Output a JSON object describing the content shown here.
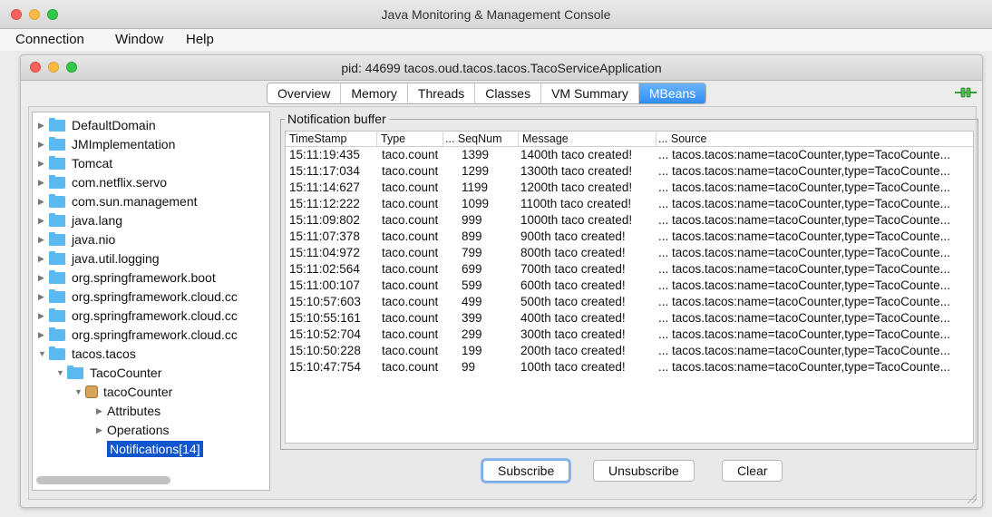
{
  "app": {
    "title": "Java Monitoring & Management Console",
    "menu": [
      "Connection",
      "Window",
      "Help"
    ]
  },
  "window": {
    "title": "pid: 44699 tacos.oud.tacos.tacos.TacoServiceApplication"
  },
  "tabs": [
    {
      "label": "Overview",
      "active": false
    },
    {
      "label": "Memory",
      "active": false
    },
    {
      "label": "Threads",
      "active": false
    },
    {
      "label": "Classes",
      "active": false
    },
    {
      "label": "VM Summary",
      "active": false
    },
    {
      "label": "MBeans",
      "active": true
    }
  ],
  "colors": {
    "accent": "#2f8ef4",
    "selection": "#1155cc",
    "folder": "#5bb8f0"
  },
  "tree": [
    {
      "label": "DefaultDomain",
      "expanded": false,
      "level": 0,
      "icon": "folder-icon"
    },
    {
      "label": "JMImplementation",
      "expanded": false,
      "level": 0,
      "icon": "folder-icon"
    },
    {
      "label": "Tomcat",
      "expanded": false,
      "level": 0,
      "icon": "folder-icon"
    },
    {
      "label": "com.netflix.servo",
      "expanded": false,
      "level": 0,
      "icon": "folder-icon"
    },
    {
      "label": "com.sun.management",
      "expanded": false,
      "level": 0,
      "icon": "folder-icon"
    },
    {
      "label": "java.lang",
      "expanded": false,
      "level": 0,
      "icon": "folder-icon"
    },
    {
      "label": "java.nio",
      "expanded": false,
      "level": 0,
      "icon": "folder-icon"
    },
    {
      "label": "java.util.logging",
      "expanded": false,
      "level": 0,
      "icon": "folder-icon"
    },
    {
      "label": "org.springframework.boot",
      "expanded": false,
      "level": 0,
      "icon": "folder-icon"
    },
    {
      "label": "org.springframework.cloud.cc",
      "expanded": false,
      "level": 0,
      "icon": "folder-icon"
    },
    {
      "label": "org.springframework.cloud.cc",
      "expanded": false,
      "level": 0,
      "icon": "folder-icon"
    },
    {
      "label": "org.springframework.cloud.cc",
      "expanded": false,
      "level": 0,
      "icon": "folder-icon"
    },
    {
      "label": "tacos.tacos",
      "expanded": true,
      "level": 0,
      "icon": "folder-icon"
    },
    {
      "label": "TacoCounter",
      "expanded": true,
      "level": 1,
      "icon": "folder-icon"
    },
    {
      "label": "tacoCounter",
      "expanded": true,
      "level": 2,
      "icon": "bean-icon"
    },
    {
      "label": "Attributes",
      "expanded": false,
      "level": 3,
      "icon": ""
    },
    {
      "label": "Operations",
      "expanded": false,
      "level": 3,
      "icon": ""
    },
    {
      "label": "Notifications[14]",
      "expanded": null,
      "level": 3,
      "icon": "",
      "selected": true
    }
  ],
  "notifications": {
    "title": "Notification buffer",
    "columns": [
      "TimeStamp",
      "Type",
      "... SeqNum",
      "Message",
      "... Source"
    ],
    "rows": [
      [
        "15:11:19:435",
        "taco.count",
        "1399",
        "1400th taco created!",
        "... tacos.tacos:name=tacoCounter,type=TacoCounte..."
      ],
      [
        "15:11:17:034",
        "taco.count",
        "1299",
        "1300th taco created!",
        "... tacos.tacos:name=tacoCounter,type=TacoCounte..."
      ],
      [
        "15:11:14:627",
        "taco.count",
        "1199",
        "1200th taco created!",
        "... tacos.tacos:name=tacoCounter,type=TacoCounte..."
      ],
      [
        "15:11:12:222",
        "taco.count",
        "1099",
        "1100th taco created!",
        "... tacos.tacos:name=tacoCounter,type=TacoCounte..."
      ],
      [
        "15:11:09:802",
        "taco.count",
        "999",
        "1000th taco created!",
        "... tacos.tacos:name=tacoCounter,type=TacoCounte..."
      ],
      [
        "15:11:07:378",
        "taco.count",
        "899",
        "900th taco created!",
        "... tacos.tacos:name=tacoCounter,type=TacoCounte..."
      ],
      [
        "15:11:04:972",
        "taco.count",
        "799",
        "800th taco created!",
        "... tacos.tacos:name=tacoCounter,type=TacoCounte..."
      ],
      [
        "15:11:02:564",
        "taco.count",
        "699",
        "700th taco created!",
        "... tacos.tacos:name=tacoCounter,type=TacoCounte..."
      ],
      [
        "15:11:00:107",
        "taco.count",
        "599",
        "600th taco created!",
        "... tacos.tacos:name=tacoCounter,type=TacoCounte..."
      ],
      [
        "15:10:57:603",
        "taco.count",
        "499",
        "500th taco created!",
        "... tacos.tacos:name=tacoCounter,type=TacoCounte..."
      ],
      [
        "15:10:55:161",
        "taco.count",
        "399",
        "400th taco created!",
        "... tacos.tacos:name=tacoCounter,type=TacoCounte..."
      ],
      [
        "15:10:52:704",
        "taco.count",
        "299",
        "300th taco created!",
        "... tacos.tacos:name=tacoCounter,type=TacoCounte..."
      ],
      [
        "15:10:50:228",
        "taco.count",
        "199",
        "200th taco created!",
        "... tacos.tacos:name=tacoCounter,type=TacoCounte..."
      ],
      [
        "15:10:47:754",
        "taco.count",
        "99",
        "100th taco created!",
        "... tacos.tacos:name=tacoCounter,type=TacoCounte..."
      ]
    ]
  },
  "buttons": {
    "subscribe": "Subscribe",
    "unsubscribe": "Unsubscribe",
    "clear": "Clear"
  }
}
